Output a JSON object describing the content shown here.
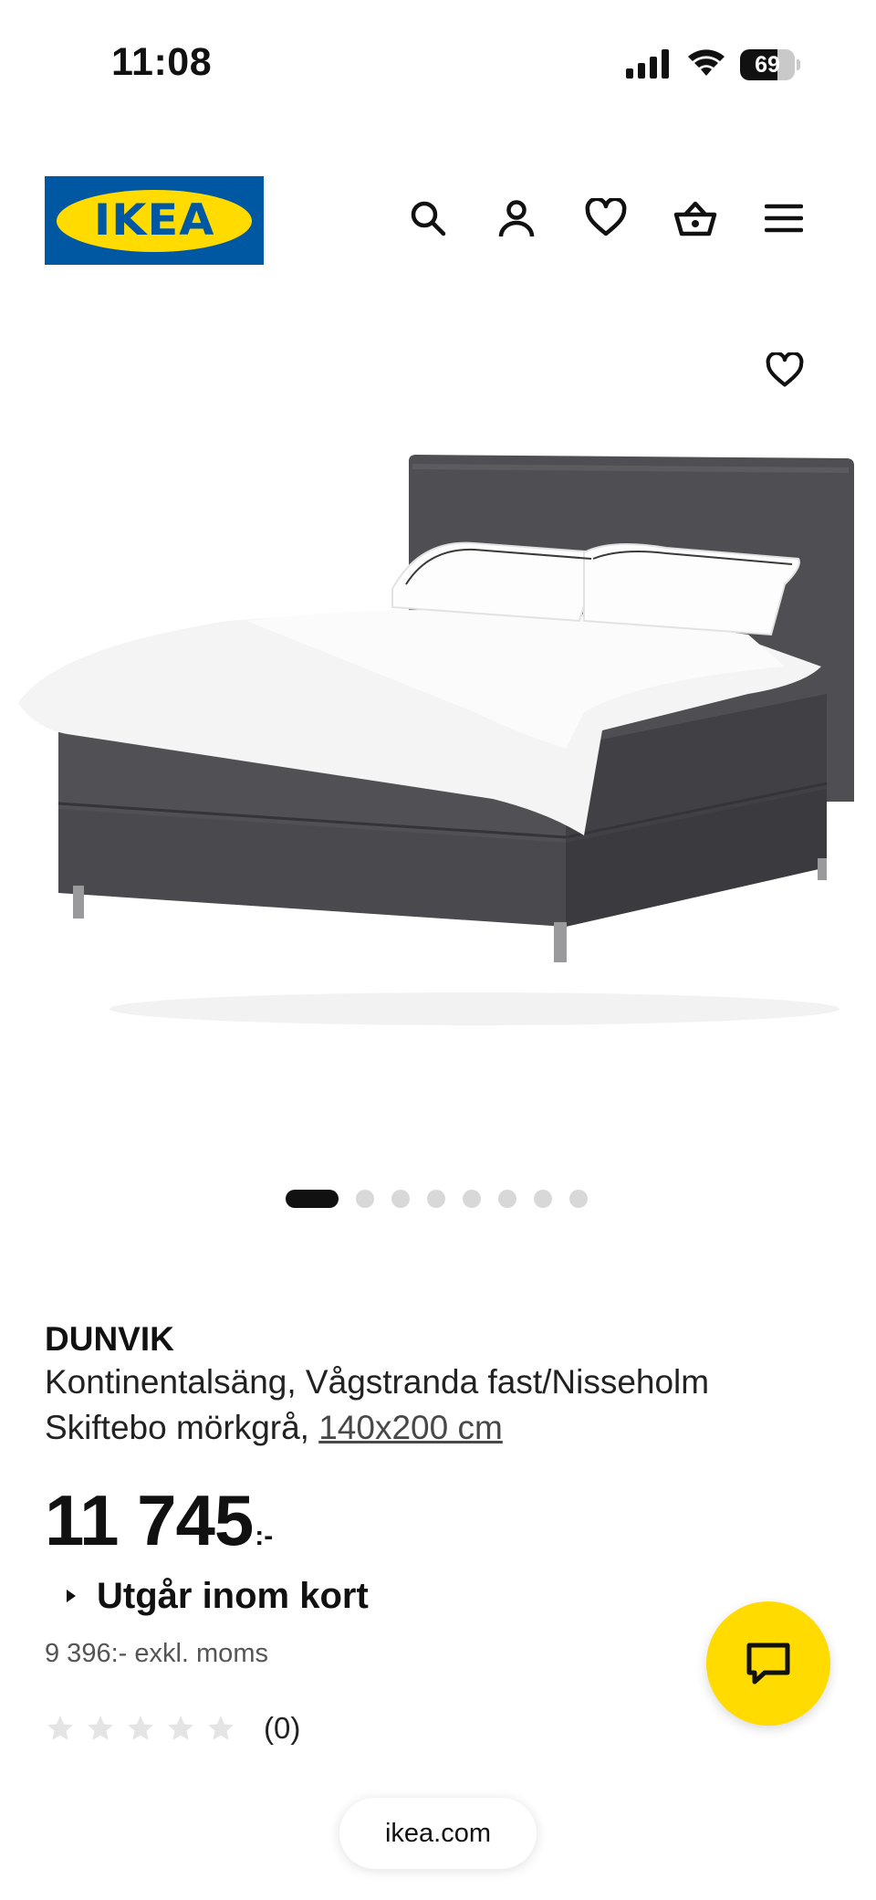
{
  "status_bar": {
    "time": "11:08",
    "battery_percent": 69,
    "battery_text": "69"
  },
  "header": {
    "logo_text": "IKEA",
    "icons": [
      "search-icon",
      "account-icon",
      "favourites-icon",
      "shopping-basket-icon",
      "menu-icon"
    ]
  },
  "product": {
    "favourite_icon": "heart-icon",
    "carousel": {
      "total": 8,
      "active_index": 0
    },
    "name": "DUNVIK",
    "description": "Kontinentalsäng, Vågstranda fast/Nisseholm Skiftebo mörkgrå,",
    "size": "140x200 cm",
    "price": "11 745",
    "price_suffix": ":-",
    "availability": "Utgår inom kort",
    "price_excl_vat": "9 396:- exkl. moms",
    "rating_stars": 0,
    "rating_max": 5,
    "rating_count": "(0)"
  },
  "chat": {
    "icon": "chat-icon"
  },
  "browser": {
    "url": "ikea.com"
  },
  "colors": {
    "ikea_blue": "#0058a3",
    "ikea_yellow": "#ffdb00",
    "text": "#111111",
    "muted": "#555555",
    "star_empty": "#e4e4e4"
  }
}
